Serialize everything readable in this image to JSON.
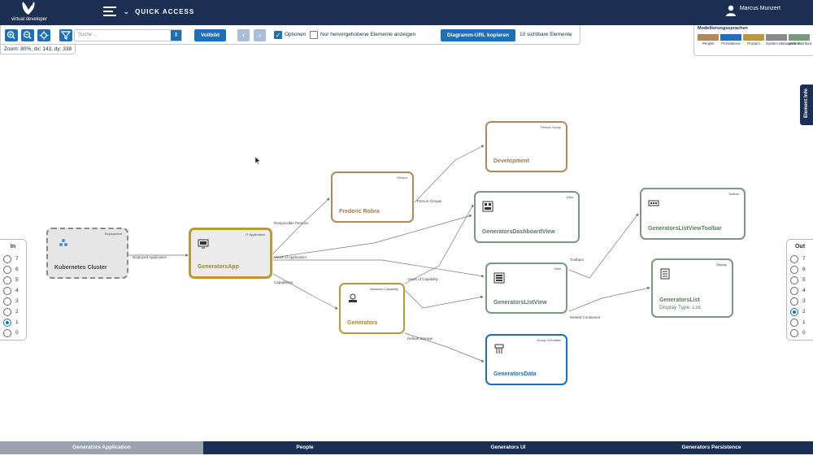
{
  "header": {
    "logo_text": "virtual developer",
    "quick_access_label": "QUICK ACCESS",
    "user_name": "Marcus Munzert"
  },
  "toolbar": {
    "search_placeholder": "Suche ...",
    "vollbild_label": "Vollbild",
    "options_label": "Optionen",
    "options_checked": true,
    "highlight_only_label": "Nur hervorgehobene Elemente anzeigen",
    "highlight_only_checked": false,
    "copy_url_label": "Diagramm-URL kopieren",
    "visible_count_label": "10 sichtbare Elemente"
  },
  "zoom_info": "Zoom: 80%, dx: 143, dy: 338",
  "legend": {
    "title": "Modellierungssprachen",
    "items": [
      {
        "label": "People",
        "color": "#b08a5e"
      },
      {
        "label": "Persistence",
        "color": "#1f6fb5"
      },
      {
        "label": "Product",
        "color": "#b89a3a"
      },
      {
        "label": "System Management",
        "color": "#8a8a8a"
      },
      {
        "label": "User Interface",
        "color": "#7a9a80"
      }
    ]
  },
  "element_info_label": "Element Info",
  "in_panel": {
    "title": "In",
    "options": [
      "7",
      "6",
      "5",
      "4",
      "3",
      "2",
      "1",
      "0"
    ],
    "selected": "1"
  },
  "out_panel": {
    "title": "Out",
    "options": [
      "7",
      "6",
      "5",
      "4",
      "3",
      "2",
      "1",
      "0"
    ],
    "selected": "2"
  },
  "nodes": [
    {
      "id": "kubernetes",
      "name": "Kubernetes Cluster",
      "type": "Deployment",
      "icon": "cluster-icon",
      "color": "#8a8a8a"
    },
    {
      "id": "generatorsapp",
      "name": "GeneratorsApp",
      "type": "IT Application",
      "icon": "monitor-icon",
      "color": "#b89a3a"
    },
    {
      "id": "frederic",
      "name": "Frederic Robra",
      "type": "Person",
      "icon": "",
      "color": "#b08a5e"
    },
    {
      "id": "development",
      "name": "Development",
      "type": "Person Group",
      "icon": "",
      "color": "#b08a5e"
    },
    {
      "id": "generators",
      "name": "Generators",
      "type": "Business Capability",
      "icon": "capability-icon",
      "color": "#b89a3a"
    },
    {
      "id": "dashboardview",
      "name": "GeneratorsDashboardView",
      "type": "View",
      "icon": "view-icon",
      "color": "#7a9a80"
    },
    {
      "id": "listview",
      "name": "GeneratorsListView",
      "type": "View",
      "icon": "view-icon",
      "color": "#7a9a80"
    },
    {
      "id": "generatorsdata",
      "name": "GeneratorsData",
      "type": "Group of Entities",
      "icon": "entities-icon",
      "color": "#1f6fb5"
    },
    {
      "id": "toolbar",
      "name": "GeneratorsListViewToolbar",
      "type": "Toolbar",
      "icon": "toolbar-icon",
      "color": "#7a9a80"
    },
    {
      "id": "generatorslist",
      "name": "GeneratorsList",
      "type": "Display",
      "sub": "Display Type: List",
      "icon": "list-icon",
      "color": "#7a9a80"
    }
  ],
  "edges": [
    {
      "label": "Deployed Application"
    },
    {
      "label": "Responsible Persons"
    },
    {
      "label": "Person Groups"
    },
    {
      "label": "Views of Application"
    },
    {
      "label": "Capabilities"
    },
    {
      "label": "Views of Capability"
    },
    {
      "label": "Toolbars"
    },
    {
      "label": "Default Storage"
    },
    {
      "label": "Nested Containers"
    }
  ],
  "bottom_tabs": [
    {
      "label": "Generators Application",
      "active": true
    },
    {
      "label": "People",
      "active": false
    },
    {
      "label": "Generators UI",
      "active": false
    },
    {
      "label": "Generators Persistence",
      "active": false
    }
  ]
}
